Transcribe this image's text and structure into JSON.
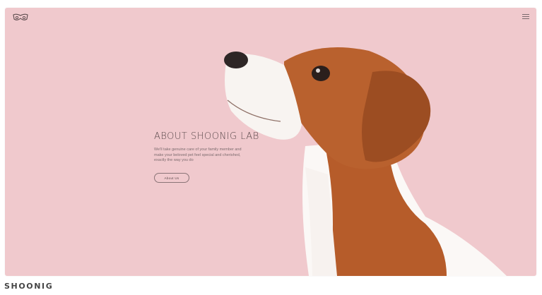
{
  "hero": {
    "title": "ABOUT SHOONIG LAB",
    "description": "We'll take genuine care of your family member and make your beloved pet feel special and cherished, exactly the way you do",
    "button_label": "About Us"
  },
  "footer": {
    "brand": "SHOONIG"
  },
  "icons": {
    "logo": "cat-face-logo-icon",
    "menu": "hamburger-menu-icon"
  },
  "colors": {
    "background": "#f0c9cd",
    "text": "#5b4a4c"
  }
}
